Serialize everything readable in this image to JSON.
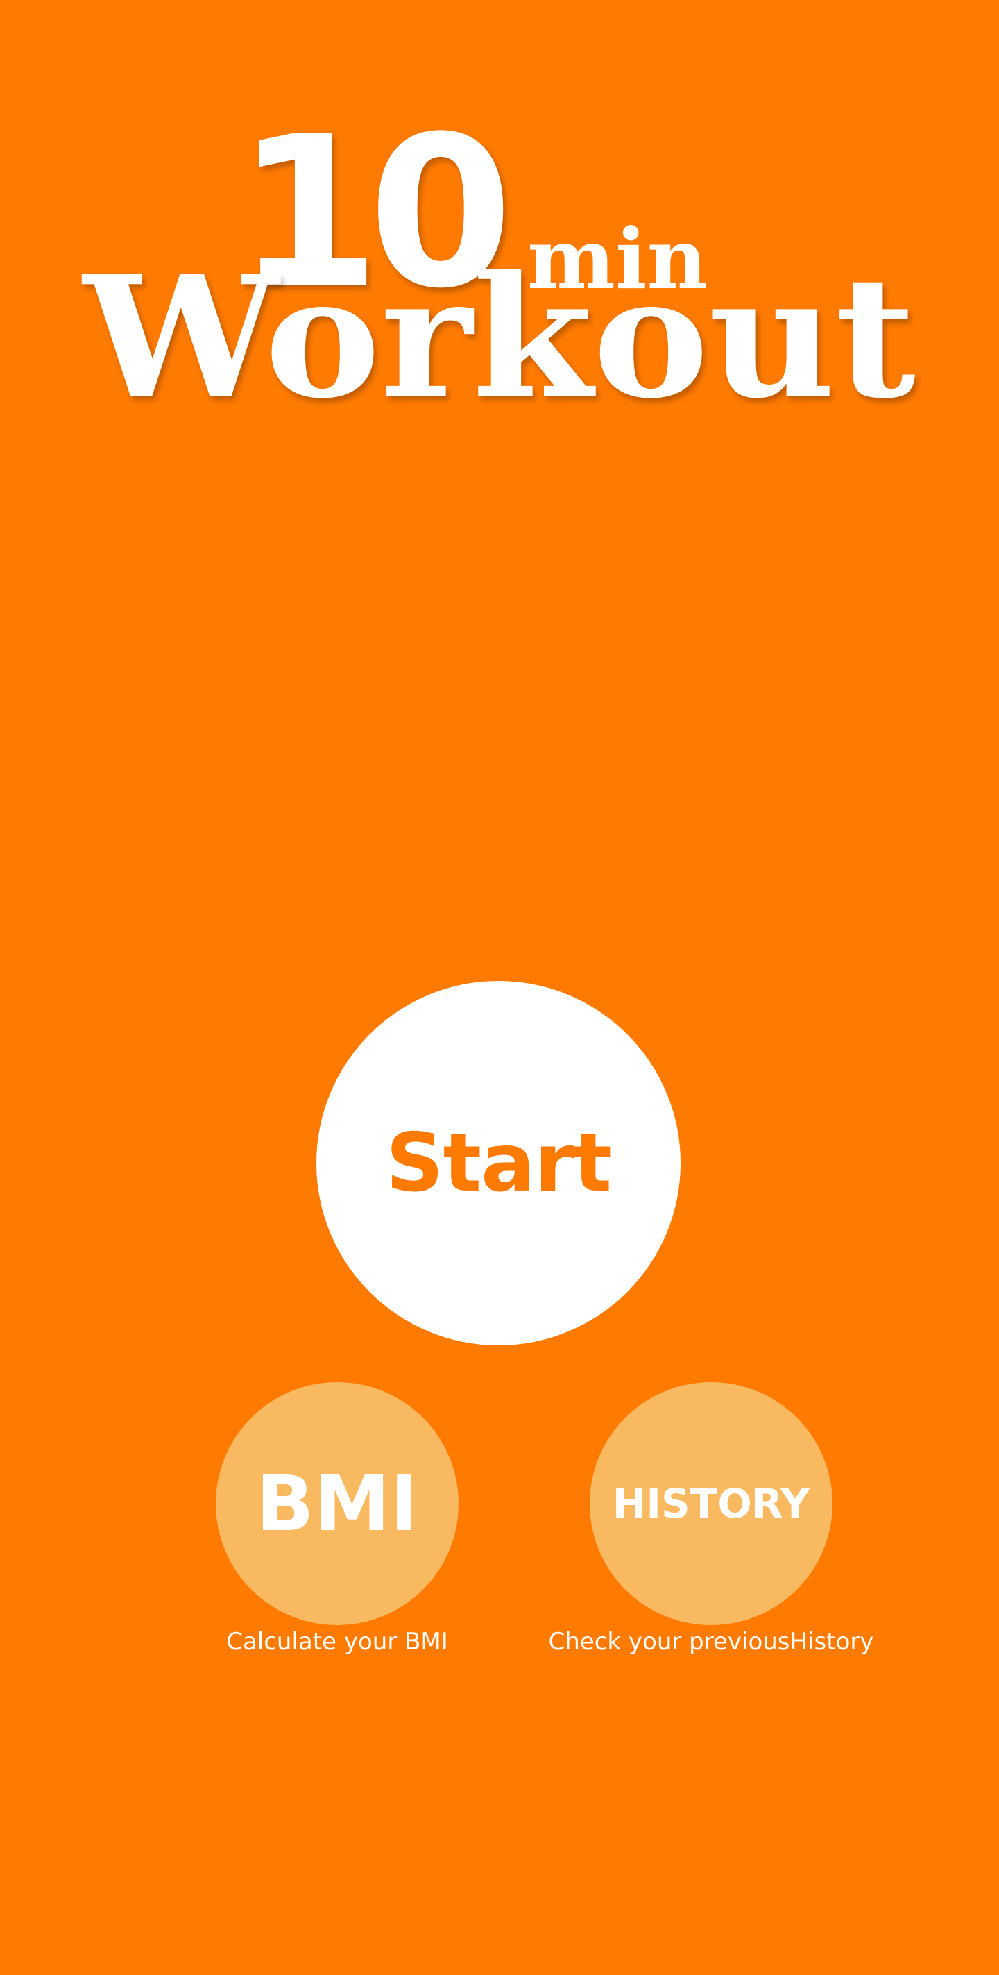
{
  "colors": {
    "background": "#FF7A00",
    "start_button_bg": "#FFFFFF",
    "start_label": "#FF7A00",
    "secondary_button_bg": "#F8B960",
    "text": "#FFFFFF"
  },
  "logo": {
    "number": "10",
    "unit": "min",
    "word": "Workout"
  },
  "start_button": {
    "label": "Start"
  },
  "bmi_button": {
    "label": "BMI",
    "caption": "Calculate your BMI"
  },
  "history_button": {
    "label": "HISTORY",
    "caption": "Check your previousHistory"
  }
}
